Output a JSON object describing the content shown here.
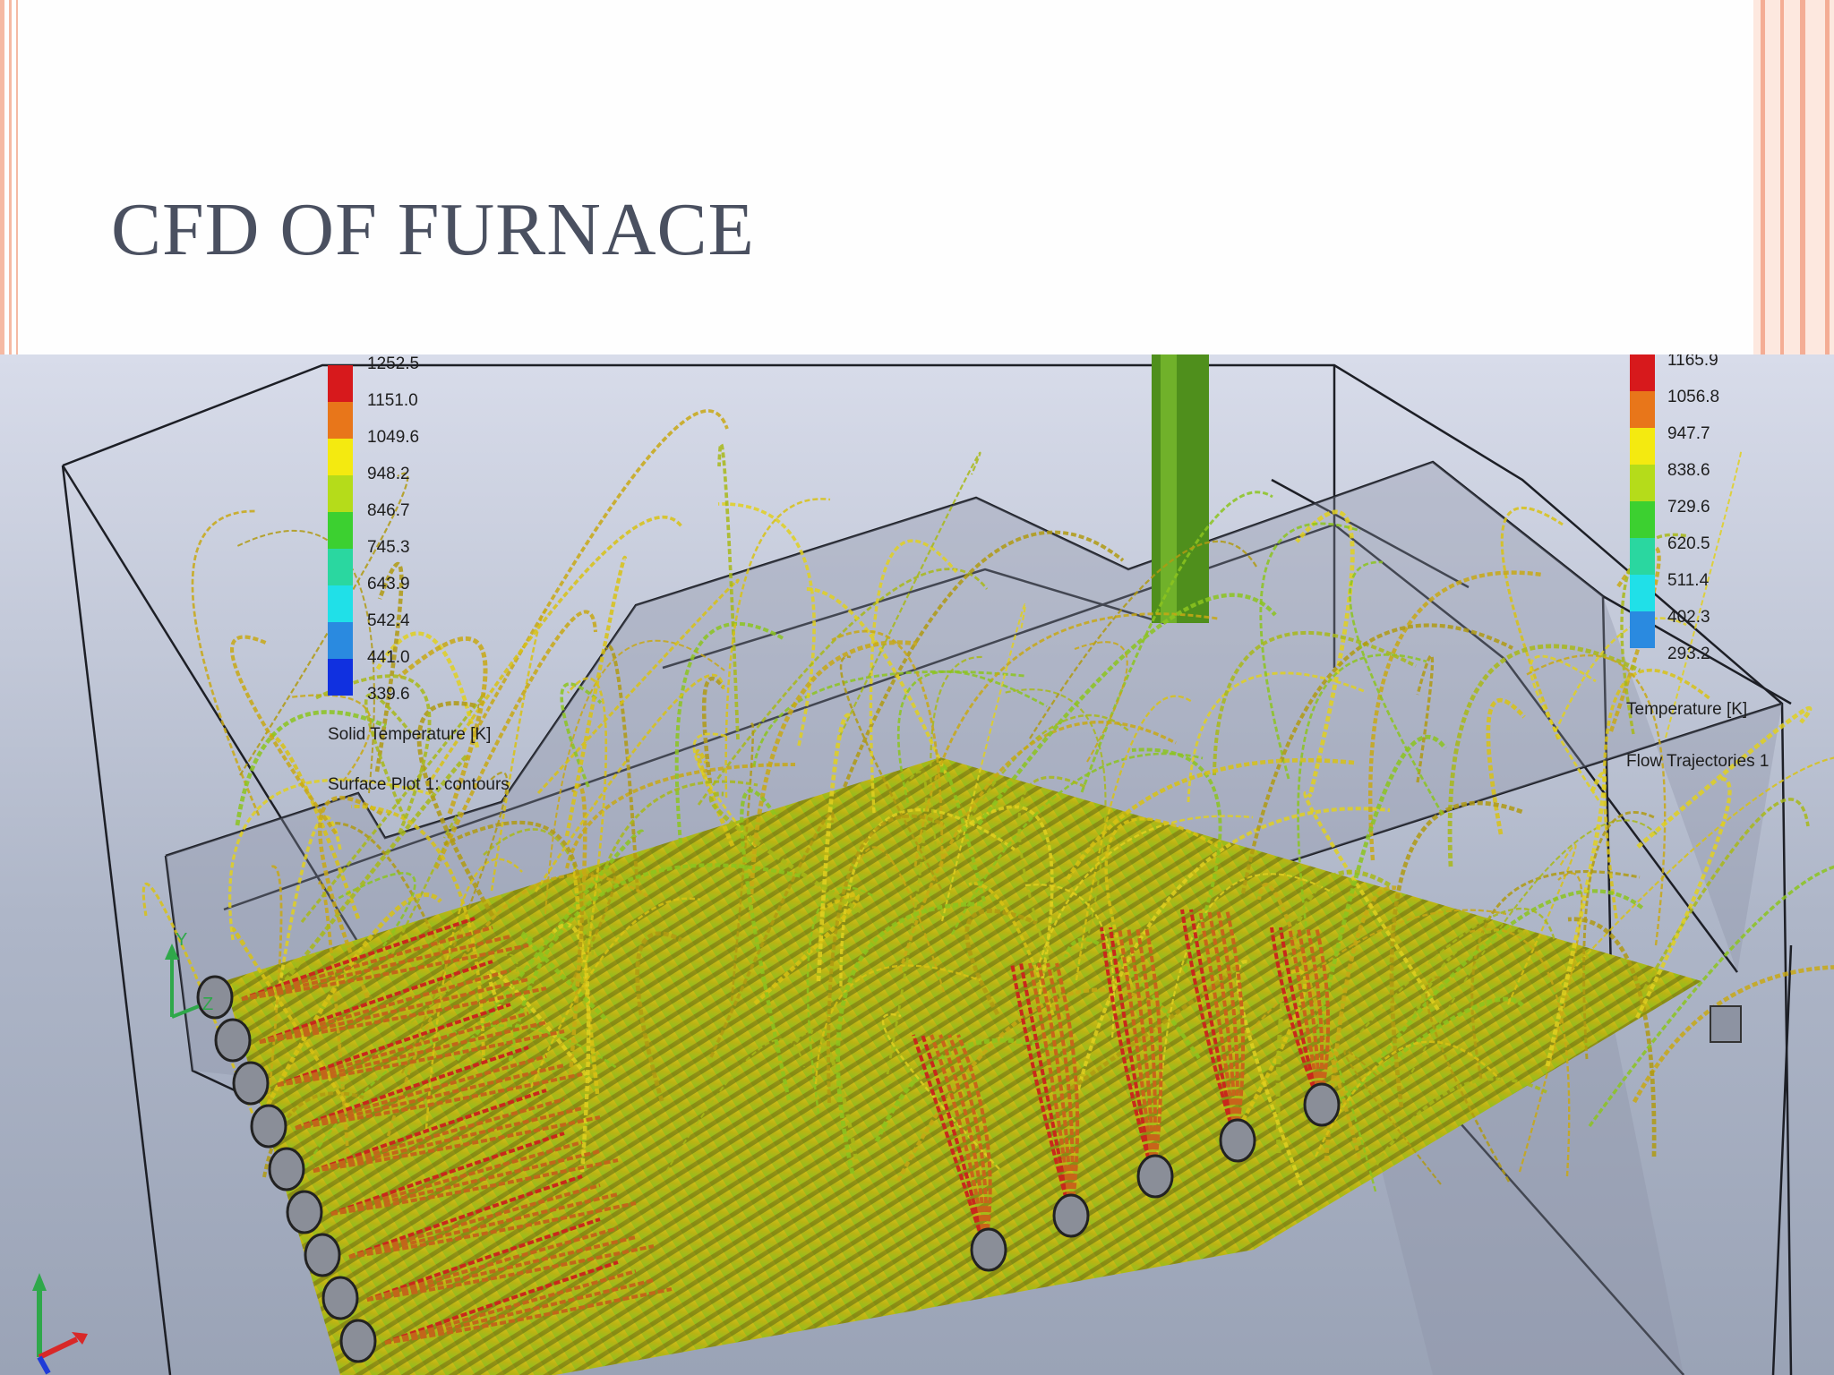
{
  "slide": {
    "title": "CFD OF FURNACE"
  },
  "legend_left": {
    "values": [
      "1252.5",
      "1151.0",
      "1049.6",
      "948.2",
      "846.7",
      "745.3",
      "643.9",
      "542.4",
      "441.0",
      "339.6"
    ],
    "label": "Solid Temperature [K]",
    "plot_label": "Surface Plot 1: contours"
  },
  "legend_right": {
    "values": [
      "1165.9",
      "1056.8",
      "947.7",
      "838.6",
      "729.6",
      "620.5",
      "511.4",
      "402.3",
      "293.2"
    ],
    "label": "Temperature [K]",
    "plot_label": "Flow Trajectories 1"
  },
  "axes": {
    "triad_y": "Y",
    "triad_z": "Z"
  },
  "colors": {
    "scale": [
      "#d7191c",
      "#e8761a",
      "#f4ea10",
      "#b5dc1a",
      "#3cd030",
      "#2ad7a0",
      "#20e0e8",
      "#2a8ae0",
      "#1030e0"
    ]
  },
  "icons": [
    "axis-triad-icon",
    "coordinate-triad-icon"
  ]
}
